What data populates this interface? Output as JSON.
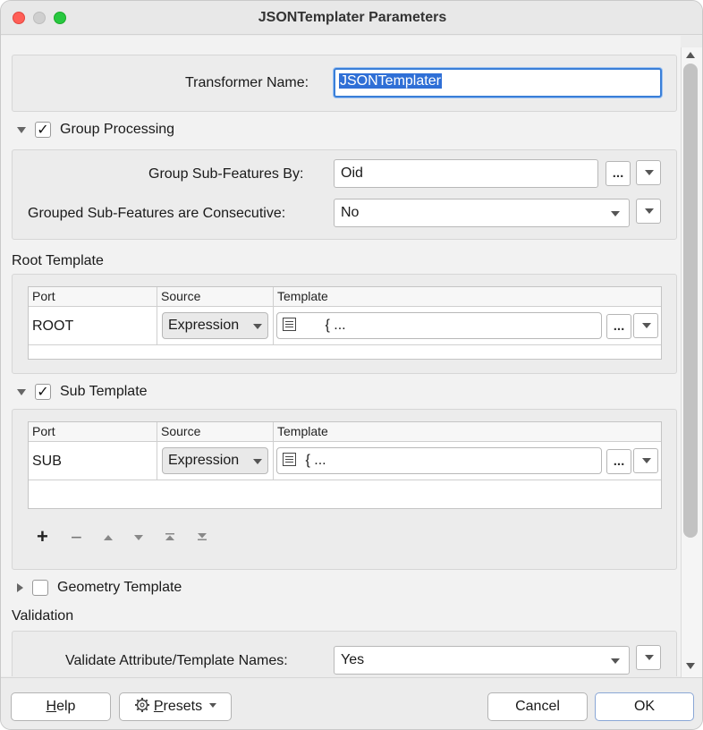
{
  "window": {
    "title": "JSONTemplater Parameters"
  },
  "transformer": {
    "label": "Transformer Name:",
    "value": "JSONTemplater"
  },
  "group_processing": {
    "label": "Group Processing",
    "checked": "✓",
    "group_by_label": "Group Sub-Features By:",
    "group_by_value": "Oid",
    "consecutive_label": "Grouped Sub-Features are Consecutive:",
    "consecutive_value": "No"
  },
  "root_template": {
    "label": "Root Template",
    "columns": [
      "Port",
      "Source",
      "Template"
    ],
    "row": {
      "port": "ROOT",
      "source": "Expression",
      "template": "{ ..."
    }
  },
  "sub_template": {
    "label": "Sub Template",
    "checked": "✓",
    "columns": [
      "Port",
      "Source",
      "Template"
    ],
    "row": {
      "port": "SUB",
      "source": "Expression",
      "template": "{ ..."
    }
  },
  "geometry_template": {
    "label": "Geometry Template"
  },
  "validation": {
    "label": "Validation",
    "validate_label": "Validate Attribute/Template Names:",
    "validate_value": "Yes"
  },
  "buttons": {
    "ellipsis": "...",
    "help_h": "H",
    "help_rest": "elp",
    "presets_p": "P",
    "presets_rest": "resets",
    "cancel": "Cancel",
    "ok": "OK"
  },
  "icons": {
    "add": "+",
    "remove": "−"
  }
}
